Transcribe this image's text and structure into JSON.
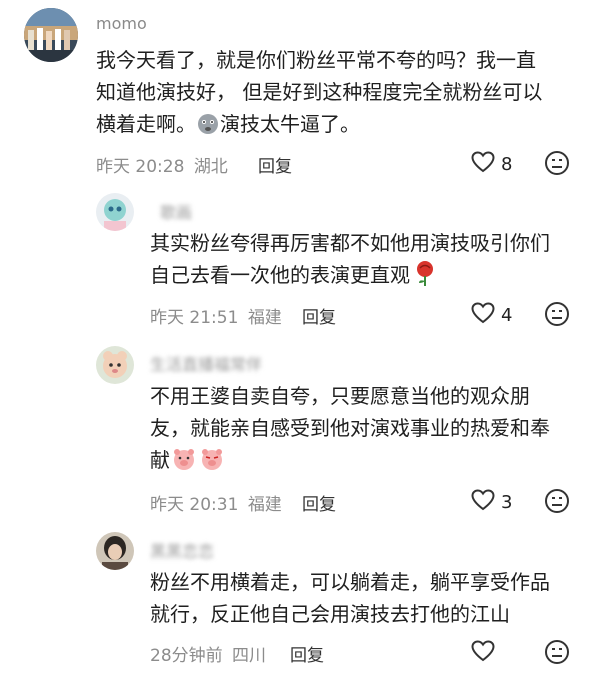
{
  "comments": [
    {
      "username": "momo",
      "lines": [
        "我今天看了，就是你们粉丝平常不夸的吗？我一直",
        "知道他演技好， 但是好到这种程度完全就粉丝可以",
        "横着走啊。",
        "演技太牛逼了。"
      ],
      "time": "昨天 20:28",
      "location": "湖北",
      "reply_label": "回复",
      "likes": "8"
    },
    {
      "username": "歌画",
      "lines": [
        "其实粉丝夸得再厉害都不如他用演技吸引你们",
        "自己去看一次他的表演更直观"
      ],
      "time": "昨天 21:51",
      "location": "福建",
      "reply_label": "回复",
      "likes": "4"
    },
    {
      "username": "生活直播福常伴",
      "lines": [
        "不用王婆自卖自夸，只要愿意当他的观众朋",
        "友，就能亲自感受到他对演戏事业的热爱和奉",
        "献"
      ],
      "time": "昨天 20:31",
      "location": "福建",
      "reply_label": "回复",
      "likes": "3"
    },
    {
      "username": "黑黑恋恋",
      "lines": [
        "粉丝不用横着走，可以躺着走，躺平享受作品",
        "就行，反正他自己会用演技去打他的江山"
      ],
      "time": "28分钟前",
      "location": "四川",
      "reply_label": "回复",
      "likes": ""
    }
  ]
}
